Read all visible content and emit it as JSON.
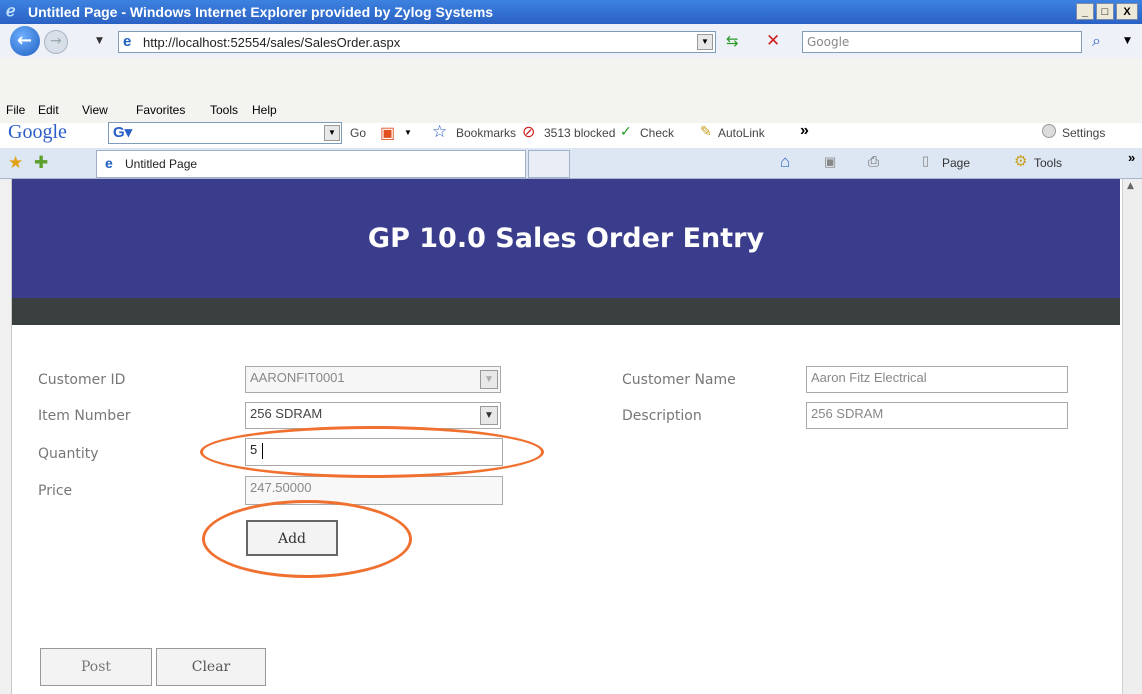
{
  "window": {
    "title": "Untitled Page - Windows Internet Explorer provided by Zylog Systems",
    "minimize": "_",
    "maximize": "□",
    "close": "X"
  },
  "address": {
    "url": "http://localhost:52554/sales/SalesOrder.aspx",
    "search_placeholder": "Google"
  },
  "menu": [
    "File",
    "Edit",
    "View",
    "Favorites",
    "Tools",
    "Help"
  ],
  "google_toolbar": {
    "logo": "Google",
    "go": "Go",
    "bookmarks": "Bookmarks",
    "blocked": "3513 blocked",
    "check": "Check",
    "autolink": "AutoLink",
    "more": "»",
    "settings": "Settings"
  },
  "tabs": {
    "active_tab": "Untitled Page",
    "page": "Page",
    "tools": "Tools",
    "more": "»"
  },
  "page": {
    "heading": "GP 10.0 Sales Order Entry",
    "form": {
      "customer_id_label": "Customer ID",
      "customer_id_value": "AARONFIT0001",
      "item_number_label": "Item Number",
      "item_number_value": "256 SDRAM",
      "quantity_label": "Quantity",
      "quantity_value": "5",
      "price_label": "Price",
      "price_value": "247.50000",
      "customer_name_label": "Customer Name",
      "customer_name_value": "Aaron Fitz Electrical",
      "description_label": "Description",
      "description_value": "256 SDRAM",
      "add_button": "Add",
      "post_button": "Post",
      "clear_button": "Clear"
    }
  },
  "colors": {
    "banner": "#3a3c8c",
    "dark_bar": "#3a3f3f",
    "highlight": "#f07030"
  }
}
